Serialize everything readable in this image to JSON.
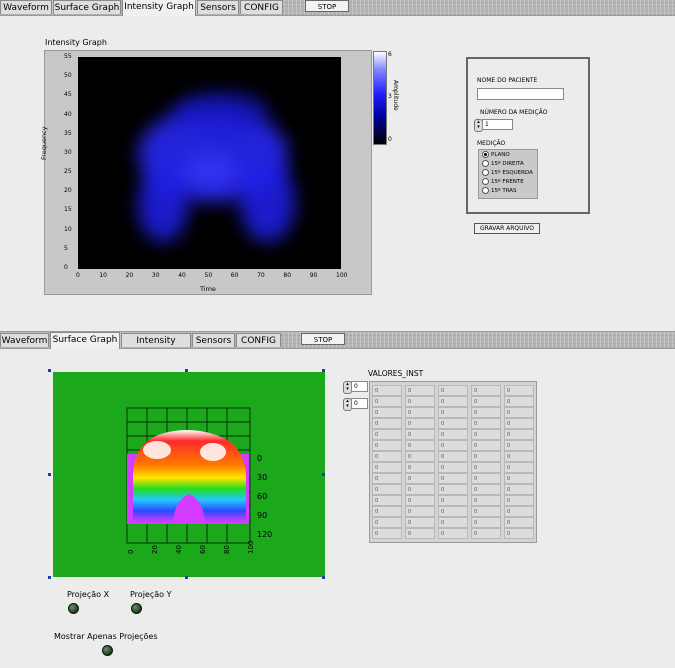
{
  "top_panel": {
    "tabs": [
      "Waveform",
      "Surface Graph",
      "Intensity Graph",
      "Sensors",
      "CONFIG"
    ],
    "active_tab": "Intensity Graph",
    "stop_label": "STOP",
    "intensity_graph": {
      "title": "Intensity Graph",
      "xlabel": "Time",
      "ylabel": "Frequency",
      "x_ticks": [
        "0",
        "10",
        "20",
        "30",
        "40",
        "50",
        "60",
        "70",
        "80",
        "90",
        "100"
      ],
      "y_ticks": [
        "55",
        "50",
        "45",
        "40",
        "35",
        "30",
        "25",
        "20",
        "15",
        "10",
        "5",
        "0"
      ],
      "colorbar_label": "Amplitude",
      "colorbar_ticks": [
        "6",
        "3",
        "0"
      ]
    },
    "patient": {
      "name_label": "NOME DO PACIENTE",
      "name_value": "",
      "measurement_number_label": "NÚMERO DA MEDIÇÃO",
      "measurement_number_value": "1",
      "measurement_label": "MEDIÇÃO",
      "options": [
        "PLANO",
        "15º DIREITA",
        "15º ESQUERDA",
        "15º FRENTE",
        "15º TRAS"
      ],
      "selected_option": "PLANO",
      "save_button": "GRAVAR ARQUIVO"
    }
  },
  "bottom_panel": {
    "tabs": [
      "Waveform",
      "Surface Graph",
      "Intensity Graph",
      "Sensors",
      "CONFIG"
    ],
    "active_tab": "Surface Graph",
    "stop_label": "STOP",
    "surface_graph": {
      "y_ticks": [
        "0",
        "30",
        "60",
        "90",
        "120"
      ],
      "x_ticks": [
        "0",
        "20",
        "40",
        "60",
        "80",
        "100"
      ]
    },
    "valores": {
      "title": "VALORES_INST",
      "index_values": [
        "0",
        "0"
      ],
      "cells": [
        [
          "0",
          "0",
          "0",
          "0",
          "0"
        ],
        [
          "0",
          "0",
          "0",
          "0",
          "0"
        ],
        [
          "0",
          "0",
          "0",
          "0",
          "0"
        ],
        [
          "0",
          "0",
          "0",
          "0",
          "0"
        ],
        [
          "0",
          "0",
          "0",
          "0",
          "0"
        ],
        [
          "0",
          "0",
          "0",
          "0",
          "0"
        ],
        [
          "0",
          "0",
          "0",
          "0",
          "0"
        ],
        [
          "0",
          "0",
          "0",
          "0",
          "0"
        ],
        [
          "0",
          "0",
          "0",
          "0",
          "0"
        ],
        [
          "0",
          "0",
          "0",
          "0",
          "0"
        ],
        [
          "0",
          "0",
          "0",
          "0",
          "0"
        ],
        [
          "0",
          "0",
          "0",
          "0",
          "0"
        ],
        [
          "0",
          "0",
          "0",
          "0",
          "0"
        ],
        [
          "0",
          "0",
          "0",
          "0",
          "0"
        ]
      ]
    },
    "projection_x_label": "Projeção X",
    "projection_y_label": "Projeção Y",
    "only_projections_label": "Mostrar Apenas Projeções",
    "led_color": "#1e3a1e"
  }
}
